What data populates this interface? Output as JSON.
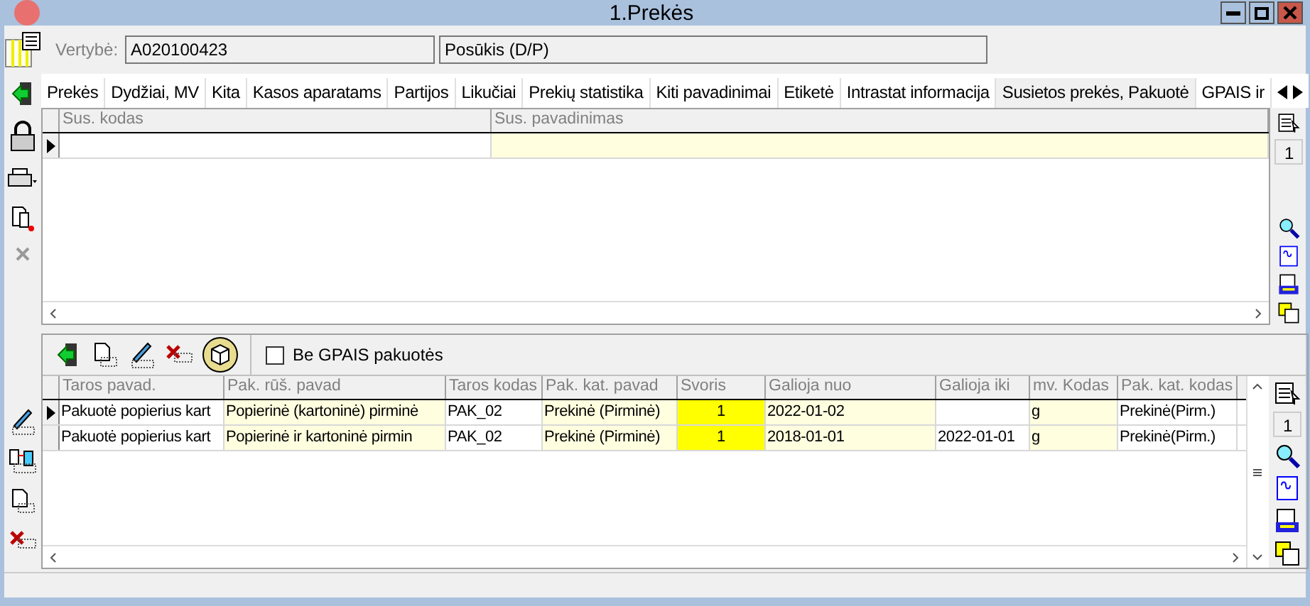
{
  "window": {
    "title": "1.Prekės"
  },
  "header": {
    "label": "Vertybė:",
    "value": "A020100423",
    "second_value": "Posūkis (D/P)"
  },
  "tabs": [
    {
      "label": "Prekės",
      "selected": false
    },
    {
      "label": "Dydžiai, MV",
      "selected": false
    },
    {
      "label": "Kita",
      "selected": false
    },
    {
      "label": "Kasos aparatams",
      "selected": false
    },
    {
      "label": "Partijos",
      "selected": false
    },
    {
      "label": "Likučiai",
      "selected": false
    },
    {
      "label": "Prekių statistika",
      "selected": false
    },
    {
      "label": "Kiti pavadinimai",
      "selected": false
    },
    {
      "label": "Etiketė",
      "selected": false
    },
    {
      "label": "Intrastat informacija",
      "selected": false
    },
    {
      "label": "Susietos prekės, Pakuotė",
      "selected": true
    },
    {
      "label": "GPAIS ir",
      "selected": false
    }
  ],
  "upper_table": {
    "columns": [
      "Sus. kodas",
      "Sus. pavadinimas"
    ],
    "rows": [
      {
        "selected": true
      }
    ],
    "record_count": "1"
  },
  "lower_panel": {
    "checkbox": {
      "label": "Be GPAIS pakuotės",
      "checked": false
    },
    "table": {
      "columns": [
        "Taros pavad.",
        "Pak. rūš. pavad",
        "Taros kodas",
        "Pak. kat. pavad",
        "Svoris",
        "Galioja nuo",
        "Galioja iki",
        "mv. Kodas",
        "Pak. kat. kodas"
      ],
      "rows": [
        {
          "selected": true,
          "cells": [
            "Pakuotė popierius kart",
            "Popierinė (kartoninė) pirminė",
            "PAK_02",
            "Prekinė (Pirminė)",
            "1",
            "2022-01-02",
            "",
            "g",
            "Prekinė(Pirm.)"
          ]
        },
        {
          "selected": false,
          "cells": [
            "Pakuotė popierius kart",
            "Popierinė ir kartoninė pirmin",
            "PAK_02",
            "Prekinė (Pirminė)",
            "1",
            "2018-01-01",
            "2022-01-01",
            "g",
            "Prekinė(Pirm.)"
          ]
        }
      ],
      "record_count": "1"
    }
  }
}
